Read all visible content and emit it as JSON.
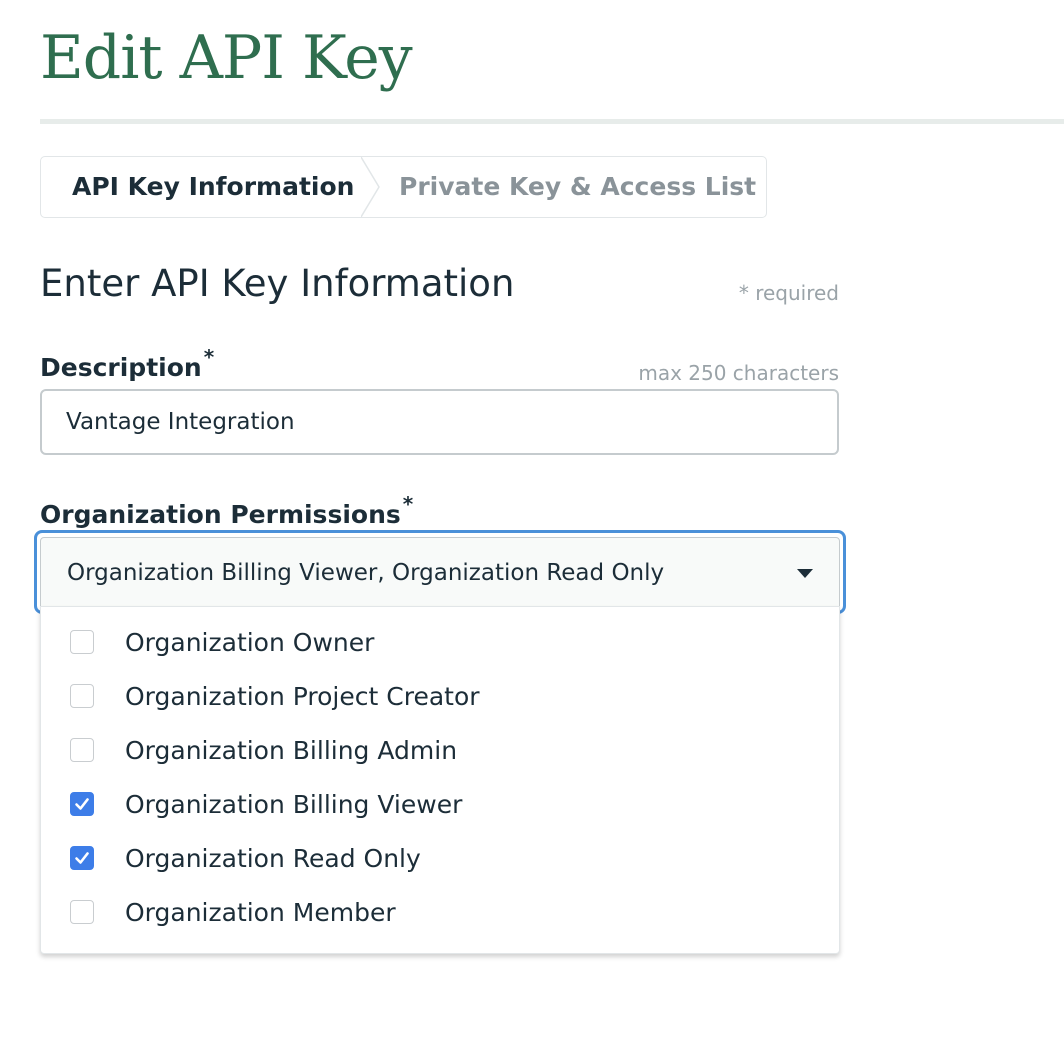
{
  "page": {
    "title": "Edit API Key"
  },
  "stepper": {
    "steps": [
      {
        "label": "API Key Information"
      },
      {
        "label": "Private Key & Access List"
      }
    ]
  },
  "form": {
    "section_title": "Enter API Key Information",
    "required_note": "* required",
    "description": {
      "label": "Description",
      "required_mark": "*",
      "max_note": "max 250 characters",
      "value": "Vantage Integration"
    },
    "permissions": {
      "label": "Organization Permissions",
      "required_mark": "*",
      "selected_text": "Organization Billing Viewer, Organization Read Only",
      "options": [
        {
          "label": "Organization Owner",
          "checked": false
        },
        {
          "label": "Organization Project Creator",
          "checked": false
        },
        {
          "label": "Organization Billing Admin",
          "checked": false
        },
        {
          "label": "Organization Billing Viewer",
          "checked": true
        },
        {
          "label": "Organization Read Only",
          "checked": true
        },
        {
          "label": "Organization Member",
          "checked": false
        }
      ]
    }
  },
  "colors": {
    "title_green": "#2f6e4f",
    "focus_blue": "#4a90d9",
    "checkbox_blue": "#3d7de8"
  },
  "icons": {
    "step_separator": "chevron-right-icon",
    "dropdown_caret": "caret-down-icon",
    "checkmark": "checkmark-icon"
  }
}
